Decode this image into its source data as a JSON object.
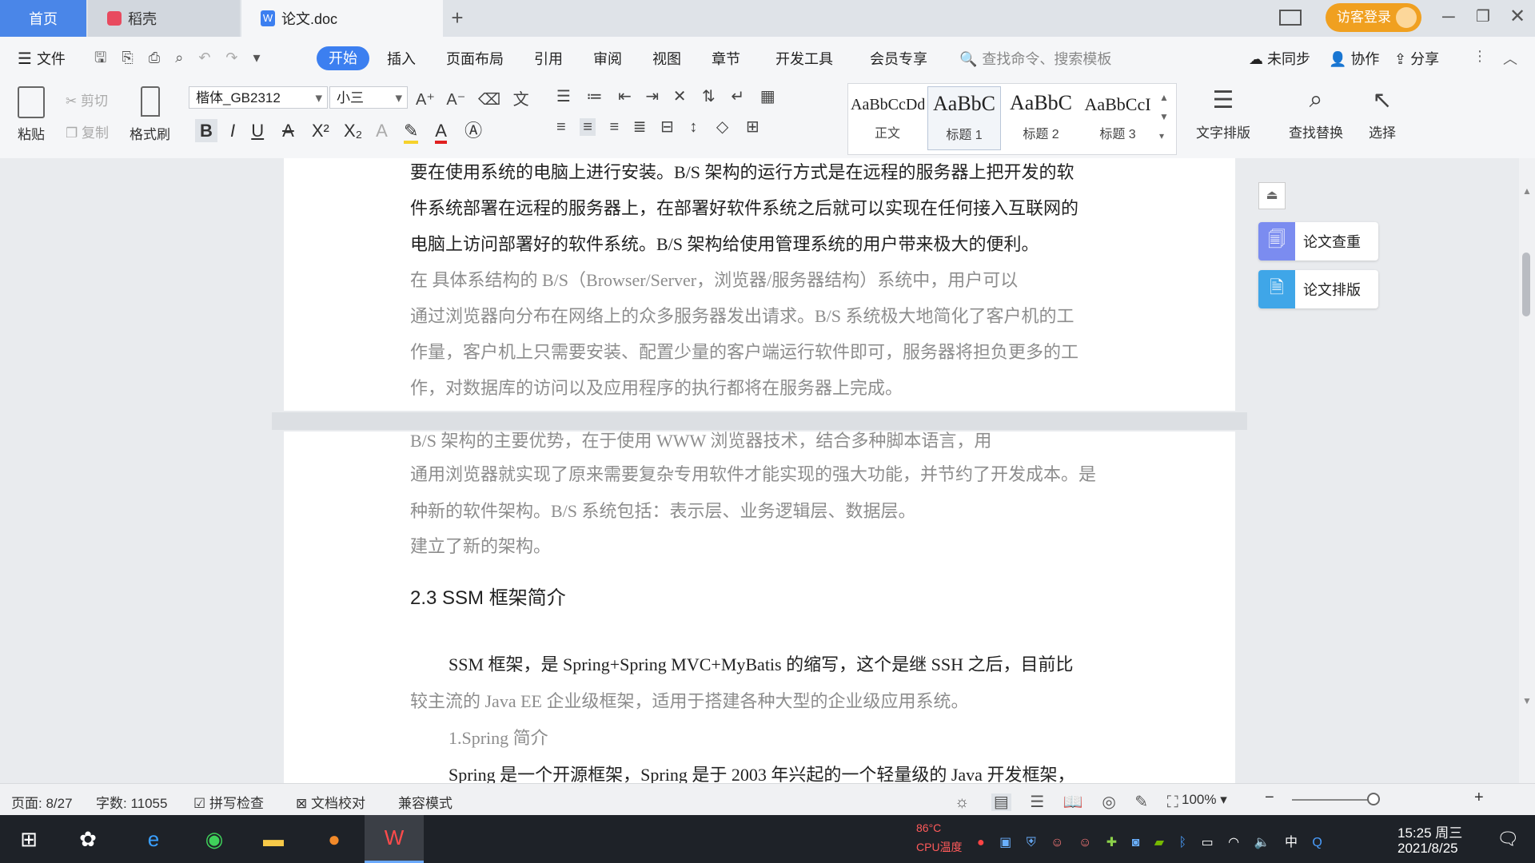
{
  "tabs": {
    "home": "首页",
    "daoke": "稻壳",
    "doc": "论文.doc",
    "login": "访客登录"
  },
  "menu": {
    "file": "文件",
    "items": [
      "开始",
      "插入",
      "页面布局",
      "引用",
      "审阅",
      "视图",
      "章节",
      "开发工具",
      "会员专享"
    ],
    "search_placeholder": "查找命令、搜索模板",
    "sync": "未同步",
    "collab": "协作",
    "share": "分享"
  },
  "toolbar": {
    "paste": "粘贴",
    "cut": "剪切",
    "copy": "复制",
    "format_painter": "格式刷",
    "font_name": "楷体_GB2312",
    "font_size": "小三",
    "styles": [
      {
        "preview": "AaBbCcDd",
        "name": "正文"
      },
      {
        "preview": "AaBbC",
        "name": "标题 1"
      },
      {
        "preview": "AaBbC",
        "name": "标题 2"
      },
      {
        "preview": "AaBbCcI",
        "name": "标题 3"
      }
    ],
    "text_layout": "文字排版",
    "find_replace": "查找替换",
    "select": "选择"
  },
  "side_panel": {
    "check": "论文查重",
    "layout": "论文排版"
  },
  "document": {
    "page1_lines": [
      "要在使用系统的电脑上进行安装。B/S 架构的运行方式是在远程的服务器上把开发的软",
      "件系统部署在远程的服务器上，在部署好软件系统之后就可以实现在任何接入互联网的",
      "电脑上访问部署好的软件系统。B/S 架构给使用管理系统的用户带来极大的便利。"
    ],
    "page1_faded": [
      "    在      具体系结构的 B/S（Browser/Server，浏览器/服务器结构）系统中，用户可以",
      "通过浏览器向分布在网络上的众多服务器发出请求。B/S 系统极大地简化了客户机的工",
      "作量，客户机上只需要安装、配置少量的客户端运行软件即可，服务器将担负更多的工",
      "作，对数据库的访问以及应用程序的执行都将在服务器上完成。"
    ],
    "page2_faded": [
      "    B/S 架构的主要优势，在于使用 WWW 浏览器技术，结合多种脚本语言，用",
      "通用浏览器就实现了原来需要复杂专用软件才能实现的强大功能，并节约了开发成本。是",
      "种新的软件架构。B/S 系统包括：表示层、业务逻辑层、数据层。",
      "建立了新的架构。"
    ],
    "heading": "2.3 SSM 框架简介",
    "para1": [
      "SSM 框架，是 Spring+Spring MVC+MyBatis 的缩写，这个是继 SSH 之后，目前比",
      "较主流的 Java EE 企业级框架，适用于搭建各种大型的企业级应用系统。"
    ],
    "sub": "1.Spring 简介",
    "para2": "Spring 是一个开源框架，Spring 是于 2003 年兴起的一个轻量级的 Java 开发框架，"
  },
  "status": {
    "page": "页面: 8/27",
    "words": "字数: 11055",
    "spell": "拼写检查",
    "proof": "文档校对",
    "compat": "兼容模式",
    "zoom": "100%"
  },
  "taskbar": {
    "cpu_temp": "86°C",
    "cpu_label": "CPU温度",
    "ime": "中",
    "time": "15:25 周三",
    "date": "2021/8/25"
  }
}
